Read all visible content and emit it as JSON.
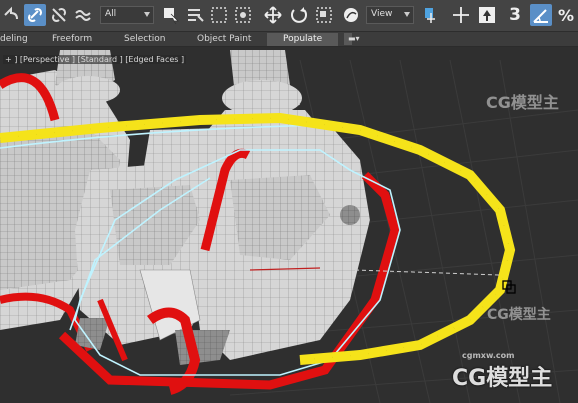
{
  "toolbar": {
    "selection_filter": "All",
    "ref_coord_system": "View",
    "snap_label": "3",
    "percent_snap_label": "%"
  },
  "ribbon": {
    "tabs": [
      "deling",
      "Freeform",
      "Selection",
      "Object Paint"
    ],
    "populate_label": "Populate"
  },
  "viewport": {
    "label": "+ ] [Perspective ] [Standard ] [Edged Faces ]"
  },
  "watermark": {
    "brand": "CG模型主",
    "url": "cgmxw.com"
  },
  "colors": {
    "spline_yellow": "#f5e31a",
    "spline_red": "#e01010",
    "spline_cyan": "#bff3ff",
    "mesh_white": "#d9d9d9",
    "grid_bg": "#2f2f2f"
  }
}
